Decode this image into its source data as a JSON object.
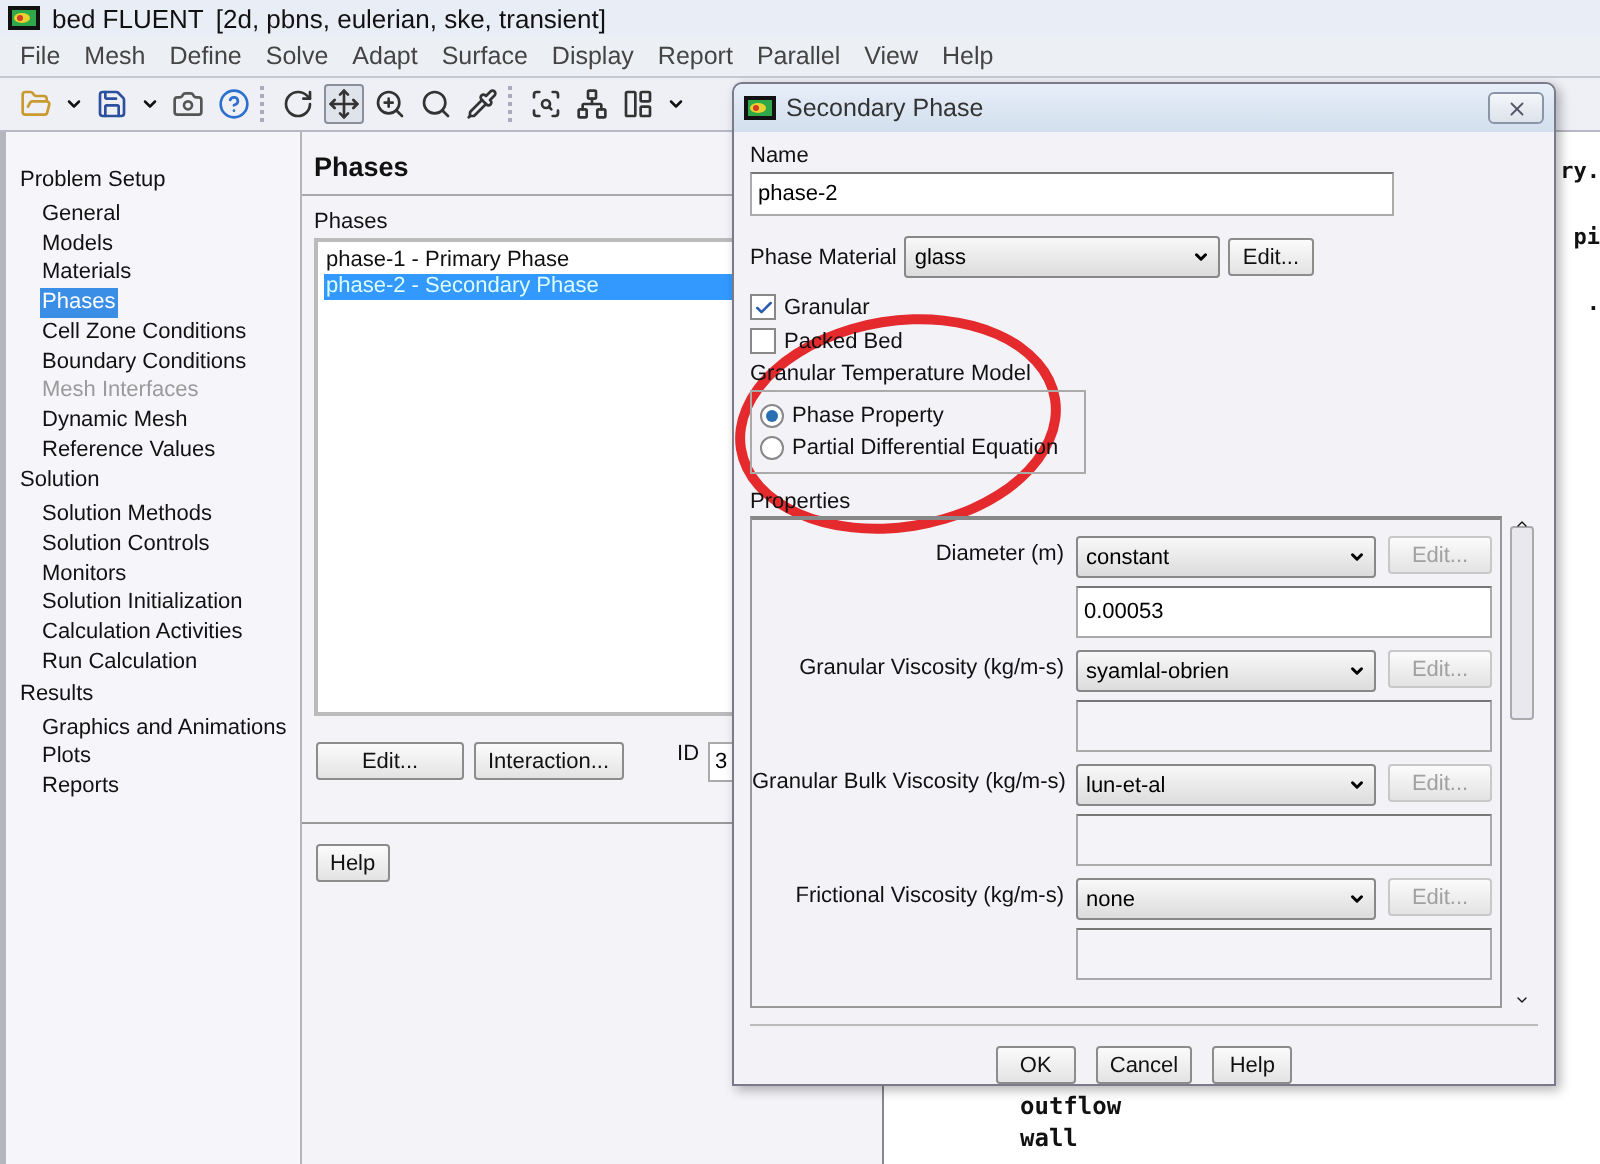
{
  "window": {
    "title": "bed FLUENT",
    "subtitle": "[2d, pbns, eulerian, ske, transient]"
  },
  "menu": [
    "File",
    "Mesh",
    "Define",
    "Solve",
    "Adapt",
    "Surface",
    "Display",
    "Report",
    "Parallel",
    "View",
    "Help"
  ],
  "toolbar": [
    [
      {
        "kind": "open",
        "pressed": false
      },
      {
        "kind": "caret",
        "pressed": false
      },
      {
        "kind": "save",
        "pressed": false
      },
      {
        "kind": "caret",
        "pressed": false
      },
      {
        "kind": "camera",
        "pressed": false
      },
      {
        "kind": "help",
        "pressed": false
      }
    ],
    [
      {
        "kind": "rotate",
        "pressed": false
      },
      {
        "kind": "move",
        "pressed": true
      },
      {
        "kind": "zoom",
        "pressed": false
      },
      {
        "kind": "zoomin",
        "pressed": false
      },
      {
        "kind": "probe",
        "pressed": false
      }
    ],
    [
      {
        "kind": "fit",
        "pressed": false
      },
      {
        "kind": "mesh",
        "pressed": false
      },
      {
        "kind": "layout",
        "pressed": false
      },
      {
        "kind": "caret",
        "pressed": false
      }
    ]
  ],
  "tree": [
    {
      "label": "Problem Setup",
      "children": [
        {
          "label": "General",
          "selected": false,
          "disabled": false
        },
        {
          "label": "Models",
          "selected": false,
          "disabled": false
        },
        {
          "label": "Materials",
          "selected": false,
          "disabled": false
        },
        {
          "label": "Phases",
          "selected": true,
          "disabled": false
        },
        {
          "label": "Cell Zone Conditions",
          "selected": false,
          "disabled": false
        },
        {
          "label": "Boundary Conditions",
          "selected": false,
          "disabled": false
        },
        {
          "label": "Mesh Interfaces",
          "selected": false,
          "disabled": true
        },
        {
          "label": "Dynamic Mesh",
          "selected": false,
          "disabled": false
        },
        {
          "label": "Reference Values",
          "selected": false,
          "disabled": false
        }
      ]
    },
    {
      "label": "Solution",
      "children": [
        {
          "label": "Solution Methods",
          "selected": false,
          "disabled": false
        },
        {
          "label": "Solution Controls",
          "selected": false,
          "disabled": false
        },
        {
          "label": "Monitors",
          "selected": false,
          "disabled": false
        },
        {
          "label": "Solution Initialization",
          "selected": false,
          "disabled": false
        },
        {
          "label": "Calculation Activities",
          "selected": false,
          "disabled": false
        },
        {
          "label": "Run Calculation",
          "selected": false,
          "disabled": false
        }
      ]
    },
    {
      "label": "Results",
      "children": [
        {
          "label": "Graphics and Animations",
          "selected": false,
          "disabled": false
        },
        {
          "label": "Plots",
          "selected": false,
          "disabled": false
        },
        {
          "label": "Reports",
          "selected": false,
          "disabled": false
        }
      ]
    }
  ],
  "phases_panel": {
    "title": "Phases",
    "list_label": "Phases",
    "items": [
      {
        "label": "phase-1 - Primary Phase",
        "selected": false
      },
      {
        "label": "phase-2 - Secondary Phase",
        "selected": true
      }
    ],
    "buttons": [
      "Edit...",
      "Interaction..."
    ],
    "id_label": "ID",
    "id_value": "3",
    "help": "Help"
  },
  "console": {
    "top_lines": [
      "ry.",
      "pi",
      "."
    ],
    "bottom_lines": [
      "outflow",
      "wall"
    ]
  },
  "dialog": {
    "title": "Secondary Phase",
    "name_label": "Name",
    "name_value": "phase-2",
    "material_label": "Phase Material",
    "material_value": "glass",
    "material_edit": "Edit...",
    "checkboxes": [
      {
        "label": "Granular",
        "checked": true
      },
      {
        "label": "Packed Bed",
        "checked": false
      }
    ],
    "temp_model_label": "Granular Temperature Model",
    "temp_models": [
      {
        "label": "Phase Property",
        "selected": true
      },
      {
        "label": "Partial Differential Equation",
        "selected": false
      }
    ],
    "properties_label": "Properties",
    "properties": [
      {
        "label": "Diameter (m)",
        "method": "constant",
        "edit": "Edit...",
        "edit_disabled": true,
        "value": "0.00053",
        "field_enabled": true
      },
      {
        "label": "Granular Viscosity (kg/m-s)",
        "method": "syamlal-obrien",
        "edit": "Edit...",
        "edit_disabled": true,
        "field_enabled": false
      },
      {
        "label": "Granular Bulk Viscosity (kg/m-s)",
        "method": "lun-et-al",
        "edit": "Edit...",
        "edit_disabled": true,
        "field_enabled": false
      },
      {
        "label": "Frictional Viscosity (kg/m-s)",
        "method": "none",
        "edit": "Edit...",
        "edit_disabled": true,
        "field_enabled": false
      }
    ],
    "buttons": [
      "OK",
      "Cancel",
      "Help"
    ]
  }
}
